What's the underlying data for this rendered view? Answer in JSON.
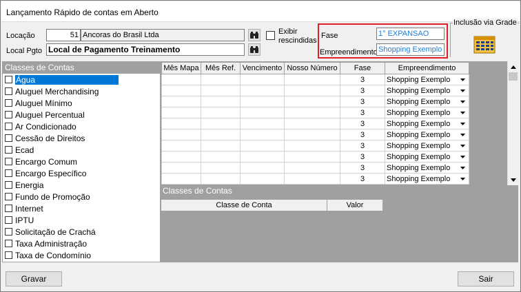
{
  "window": {
    "title": "Lançamento Rápido de contas em Aberto"
  },
  "top": {
    "locacao_label": "Locação",
    "locacao_code": "51",
    "locacao_name": "Ancoras do Brasil Ltda",
    "local_pgto_label": "Local Pgto",
    "local_pgto_value": "Local de Pagamento Treinamento",
    "exibir_label_1": "Exibir",
    "exibir_label_2": "rescindidas",
    "fase_label": "Fase",
    "fase_value": "1° EXPANSAO",
    "empreendimento_label": "Empreendimento",
    "empreendimento_value": "Shopping Exemplo",
    "inclusao_label": "Inclusão via Grade"
  },
  "classes": {
    "header": "Classes de Contas",
    "items": [
      "Água",
      "Aluguel Merchandising",
      "Aluguel Mínimo",
      "Aluguel Percentual",
      "Ar Condicionado",
      "Cessão de Direitos",
      "Ecad",
      "Encargo Comum",
      "Encargo Específico",
      "Energia",
      "Fundo de Promoção",
      "Internet",
      "IPTU",
      "Solicitação de Crachá",
      "Taxa Administração",
      "Taxa de Condomínio"
    ]
  },
  "grid": {
    "columns": [
      "Mês Mapa",
      "Mês Ref.",
      "Vencimento",
      "Nosso Número",
      "Fase",
      "Empreendimento"
    ],
    "rows": [
      {
        "fase": "3",
        "emp": "Shopping Exemplo"
      },
      {
        "fase": "3",
        "emp": "Shopping Exemplo"
      },
      {
        "fase": "3",
        "emp": "Shopping Exemplo"
      },
      {
        "fase": "3",
        "emp": "Shopping Exemplo"
      },
      {
        "fase": "3",
        "emp": "Shopping Exemplo"
      },
      {
        "fase": "3",
        "emp": "Shopping Exemplo"
      },
      {
        "fase": "3",
        "emp": "Shopping Exemplo"
      },
      {
        "fase": "3",
        "emp": "Shopping Exemplo"
      },
      {
        "fase": "3",
        "emp": "Shopping Exemplo"
      },
      {
        "fase": "3",
        "emp": "Shopping Exemplo"
      }
    ]
  },
  "classes2": {
    "header": "Classes de Contas",
    "columns": [
      "Classe de Conta",
      "Valor"
    ]
  },
  "buttons": {
    "gravar": "Gravar",
    "sair": "Sair"
  },
  "colors": {
    "selection": "#0078d7",
    "highlight_box": "#e0212a",
    "field_text_blue": "#1e7bd0",
    "panel_gray": "#a0a0a0"
  }
}
